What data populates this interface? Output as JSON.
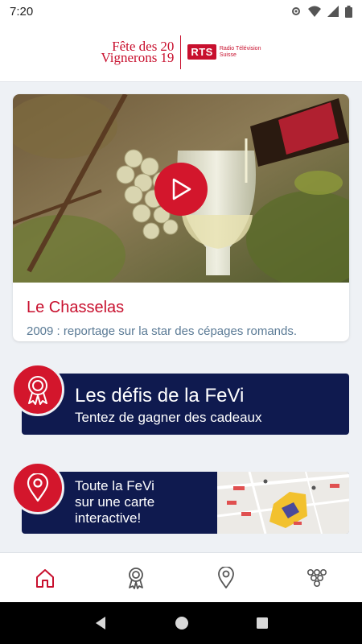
{
  "status_bar": {
    "time": "7:20"
  },
  "header": {
    "logo_line1": [
      "Fête des",
      "20"
    ],
    "logo_line2": [
      "Vignerons",
      "19"
    ],
    "rts_badge": "RTS",
    "rts_line1": "Radio Télévision",
    "rts_line2": "Suisse"
  },
  "video_card": {
    "title": "Le Chasselas",
    "description": "2009 : reportage sur la star des cépages romands.",
    "play_icon": "play-icon"
  },
  "challenges_banner": {
    "title": "Les défis de la FeVi",
    "subtitle": "Tentez de gagner des cadeaux",
    "icon": "rosette-icon"
  },
  "map_banner": {
    "line1": "Toute la FeVi",
    "line2": "sur une carte",
    "line3": "interactive!",
    "icon": "location-pin-icon"
  },
  "bottom_nav": {
    "items": [
      {
        "icon": "home-icon",
        "active": true
      },
      {
        "icon": "rosette-icon",
        "active": false
      },
      {
        "icon": "location-pin-icon",
        "active": false
      },
      {
        "icon": "grapes-icon",
        "active": false
      }
    ]
  },
  "colors": {
    "brand_red": "#d3162c",
    "navy": "#0f1a4f",
    "description_blue": "#5a7a95",
    "background": "#eef1f5"
  }
}
